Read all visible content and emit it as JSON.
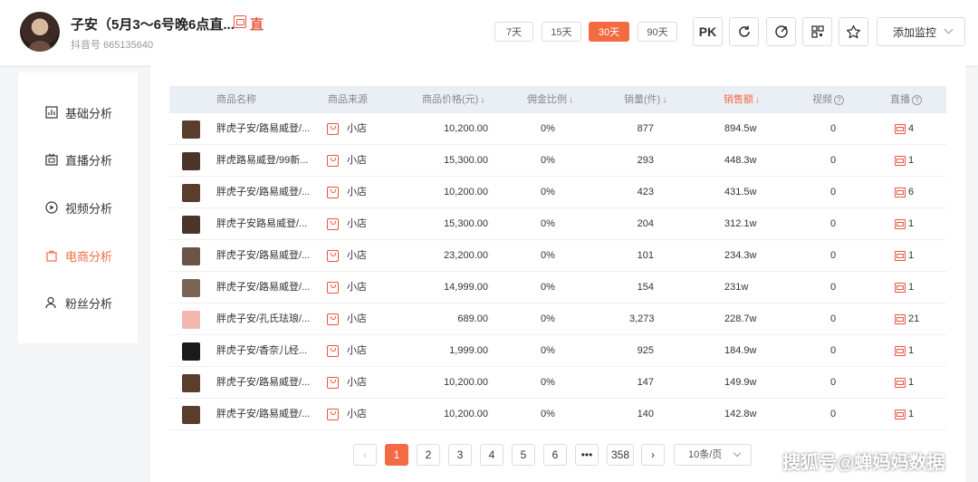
{
  "header": {
    "account_name": "子安（5月3～6号晚6点直...",
    "live_badge_text": "直",
    "account_id": "抖音号 665135640",
    "ranges": [
      "7天",
      "15天",
      "30天",
      "90天"
    ],
    "active_range": "30天",
    "pk_label": "PK",
    "monitor_label": "添加监控"
  },
  "sidebar": {
    "items": [
      {
        "label": "基础分析",
        "icon": "bar-chart-icon"
      },
      {
        "label": "直播分析",
        "icon": "live-icon"
      },
      {
        "label": "视频分析",
        "icon": "play-icon"
      },
      {
        "label": "电商分析",
        "icon": "shopping-bag-icon",
        "active": true
      },
      {
        "label": "粉丝分析",
        "icon": "user-icon"
      }
    ]
  },
  "table": {
    "columns": [
      "商品名称",
      "商品来源",
      "商品价格(元)",
      "佣金比例",
      "销量(件)",
      "销售额",
      "视频",
      "直播"
    ],
    "rows": [
      {
        "name": "胖虎子安/路易威登/...",
        "source": "小店",
        "price": "10,200.00",
        "commission": "0%",
        "sales": "877",
        "revenue": "894.5w",
        "video": "0",
        "live": "4",
        "thumb_color": "#5a3d2b"
      },
      {
        "name": "胖虎路易威登/99新...",
        "source": "小店",
        "price": "15,300.00",
        "commission": "0%",
        "sales": "293",
        "revenue": "448.3w",
        "video": "0",
        "live": "1",
        "thumb_color": "#4a3528"
      },
      {
        "name": "胖虎子安/路易威登/...",
        "source": "小店",
        "price": "10,200.00",
        "commission": "0%",
        "sales": "423",
        "revenue": "431.5w",
        "video": "0",
        "live": "6",
        "thumb_color": "#5a3d2b"
      },
      {
        "name": "胖虎子安路易威登/...",
        "source": "小店",
        "price": "15,300.00",
        "commission": "0%",
        "sales": "204",
        "revenue": "312.1w",
        "video": "0",
        "live": "1",
        "thumb_color": "#4a3528"
      },
      {
        "name": "胖虎子安/路易威登/...",
        "source": "小店",
        "price": "23,200.00",
        "commission": "0%",
        "sales": "101",
        "revenue": "234.3w",
        "video": "0",
        "live": "1",
        "thumb_color": "#6b5446"
      },
      {
        "name": "胖虎子安/路易威登/...",
        "source": "小店",
        "price": "14,999.00",
        "commission": "0%",
        "sales": "154",
        "revenue": "231w",
        "video": "0",
        "live": "1",
        "thumb_color": "#7a6555"
      },
      {
        "name": "胖虎子安/孔氏珐琅/...",
        "source": "小店",
        "price": "689.00",
        "commission": "0%",
        "sales": "3,273",
        "revenue": "228.7w",
        "video": "0",
        "live": "21",
        "thumb_color": "#f2b8b0"
      },
      {
        "name": "胖虎子安/香奈儿经...",
        "source": "小店",
        "price": "1,999.00",
        "commission": "0%",
        "sales": "925",
        "revenue": "184.9w",
        "video": "0",
        "live": "1",
        "thumb_color": "#1a1a1a"
      },
      {
        "name": "胖虎子安/路易威登/...",
        "source": "小店",
        "price": "10,200.00",
        "commission": "0%",
        "sales": "147",
        "revenue": "149.9w",
        "video": "0",
        "live": "1",
        "thumb_color": "#5a3d2b"
      },
      {
        "name": "胖虎子安/路易威登/...",
        "source": "小店",
        "price": "10,200.00",
        "commission": "0%",
        "sales": "140",
        "revenue": "142.8w",
        "video": "0",
        "live": "1",
        "thumb_color": "#5a3d2b"
      }
    ]
  },
  "pagination": {
    "pages": [
      "1",
      "2",
      "3",
      "4",
      "5",
      "6",
      "•••",
      "358"
    ],
    "current": "1",
    "page_size": "10条/页"
  },
  "watermark": "搜狐号@蝉妈妈数据",
  "colors": {
    "accent": "#f26b42",
    "live_red": "#e8553f"
  }
}
